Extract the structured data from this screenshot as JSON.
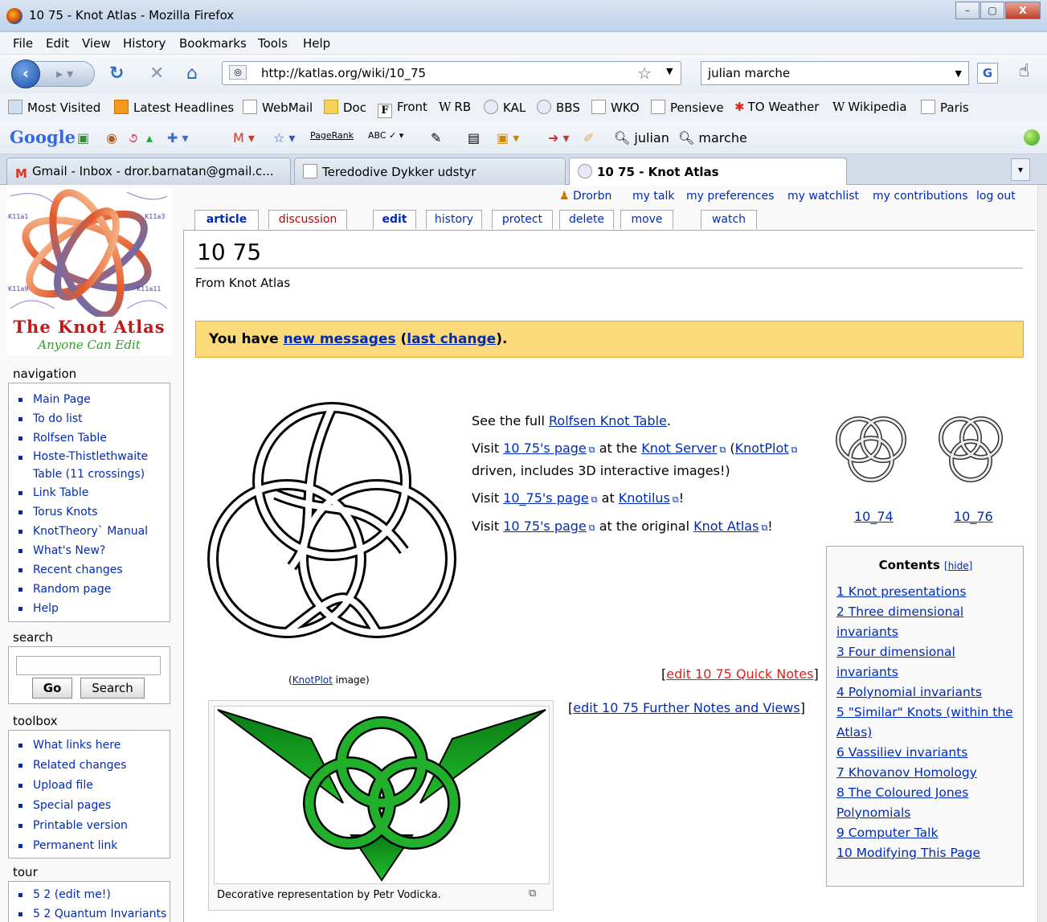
{
  "window": {
    "title": "10 75 - Knot Atlas - Mozilla Firefox",
    "btn_min": "–",
    "btn_max": "▢",
    "btn_close": "X"
  },
  "menu": [
    "File",
    "Edit",
    "View",
    "History",
    "Bookmarks",
    "Tools",
    "Help"
  ],
  "nav": {
    "url": "http://katlas.org/wiki/10_75",
    "search_value": "julian marche",
    "search_engine_letter": "G"
  },
  "bookmarks": [
    "Most Visited",
    "Latest Headlines",
    "WebMail",
    "Doc",
    "Front",
    "RB",
    "KAL",
    "BBS",
    "WKO",
    "Pensieve",
    "TO Weather",
    "Wikipedia",
    "Paris"
  ],
  "gbar": {
    "logo": "Google",
    "pagerank": "PageRank",
    "abc": "ABC",
    "search1": "julian",
    "search2": "marche"
  },
  "tabs": [
    {
      "label": "Gmail - Inbox - dror.barnatan@gmail.c..."
    },
    {
      "label": "Teredodive Dykker udstyr"
    },
    {
      "label": "10 75 - Knot Atlas"
    }
  ],
  "logo": {
    "title": "The Knot Atlas",
    "subtitle": "Anyone Can Edit",
    "labels": [
      "K11a1",
      "K11a3",
      "K11a9",
      "K11a11"
    ]
  },
  "navigation": {
    "heading": "navigation",
    "items": [
      "Main Page",
      "To do list",
      "Rolfsen Table",
      "Hoste-Thistlethwaite",
      "Table (11 crossings)",
      "Link Table",
      "Torus Knots",
      "KnotTheory` Manual",
      "What's New?",
      "Recent changes",
      "Random page",
      "Help"
    ]
  },
  "search": {
    "heading": "search",
    "go": "Go",
    "search": "Search"
  },
  "toolbox": {
    "heading": "toolbox",
    "items": [
      "What links here",
      "Related changes",
      "Upload file",
      "Special pages",
      "Printable version",
      "Permanent link"
    ]
  },
  "tour": {
    "heading": "tour",
    "items": [
      "5 2 (edit me!)",
      "5 2 Quantum Invariants"
    ]
  },
  "userbar": [
    "Drorbn",
    "my talk",
    "my preferences",
    "my watchlist",
    "my contributions",
    "log out"
  ],
  "pagetabs": [
    "article",
    "discussion",
    "edit",
    "history",
    "protect",
    "delete",
    "move",
    "watch"
  ],
  "page": {
    "title": "10 75",
    "from": "From Knot Atlas",
    "msg": {
      "pre": "You have ",
      "link1": "new messages",
      "mid": " (",
      "link2": "last change",
      "post": ")."
    },
    "p1": {
      "pre": "See the full ",
      "link": "Rolfsen Knot Table",
      "post": "."
    },
    "p2": {
      "pre": "Visit ",
      "link1": "10 75's page",
      "mid": " at the ",
      "link2": "Knot Server",
      "mid2": " (",
      "link3": "KnotPlot",
      "line2": "driven, includes 3D interactive images!)"
    },
    "p3": {
      "pre": "Visit ",
      "link": "10_75's page",
      "mid": " at ",
      "link2": "Knotilus",
      "post": "!"
    },
    "p4": {
      "pre": "Visit ",
      "link": "10 75's page",
      "mid": " at the original ",
      "link2": "Knot Atlas",
      "post": "!"
    },
    "caption": {
      "pre": "(",
      "link": "KnotPlot",
      "post": " image)"
    },
    "prev_knot": "10_74",
    "next_knot": "10_76",
    "edit_quick": {
      "open": "[",
      "link": "edit 10 75 Quick Notes",
      "close": "]"
    },
    "edit_further": {
      "open": "[",
      "link": "edit 10 75 Further Notes and Views",
      "close": "]"
    },
    "thumb_caption": "Decorative representation by Petr Vodicka."
  },
  "toc": {
    "title": "Contents",
    "hide": "[hide]",
    "items": [
      "1 Knot presentations",
      "2 Three dimensional",
      "invariants",
      "3 Four dimensional",
      "invariants",
      "4 Polynomial invariants",
      "5 \"Similar\" Knots (within the",
      "Atlas)",
      "6 Vassiliev invariants",
      "7 Khovanov Homology",
      "8 The Coloured Jones",
      "Polynomials",
      "9 Computer Talk",
      "10 Modifying This Page"
    ]
  }
}
